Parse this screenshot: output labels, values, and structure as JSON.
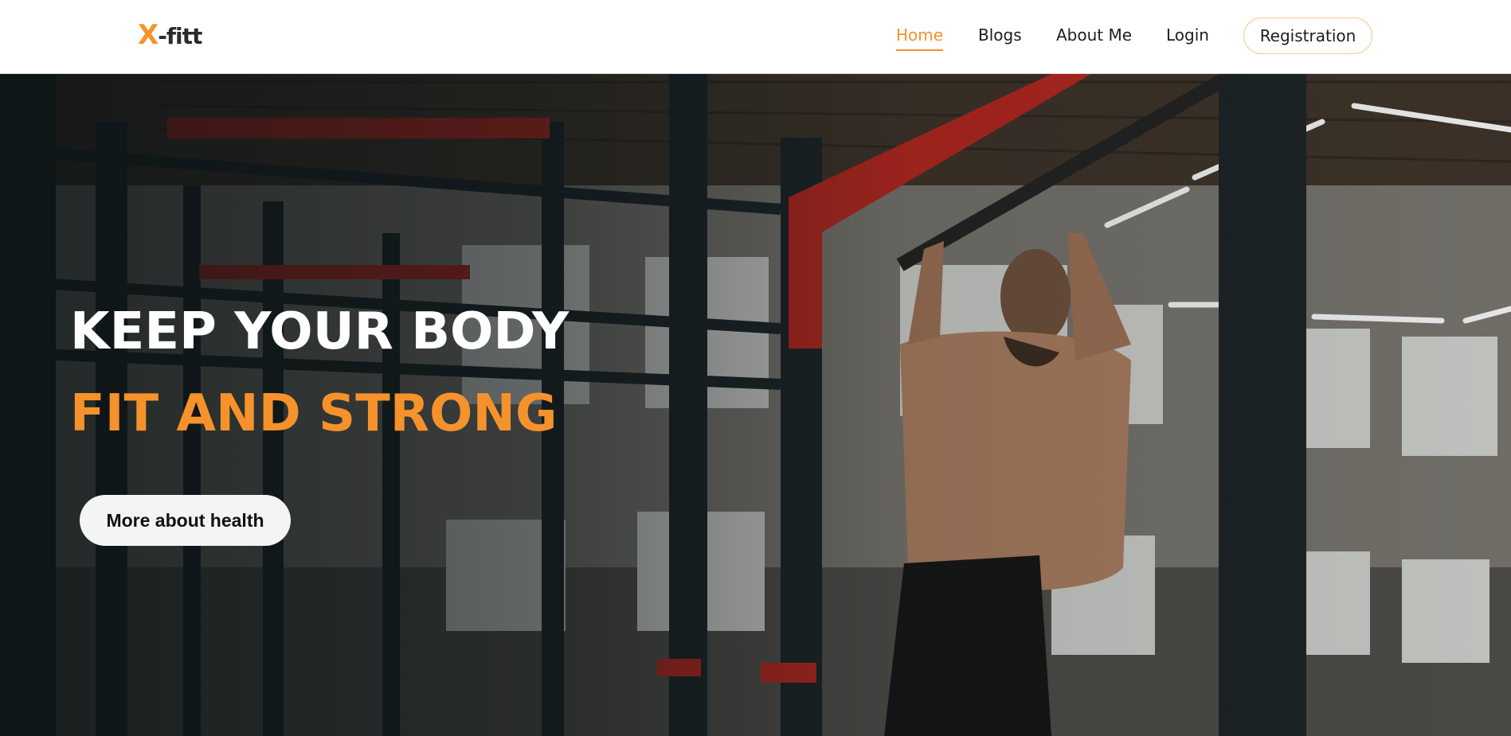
{
  "brand": {
    "logo_x": "X",
    "logo_rest": "-fitt"
  },
  "nav": {
    "links": [
      {
        "label": "Home",
        "active": true
      },
      {
        "label": "Blogs",
        "active": false
      },
      {
        "label": "About Me",
        "active": false
      },
      {
        "label": "Login",
        "active": false
      }
    ],
    "registration_label": "Registration"
  },
  "hero": {
    "line1": "KEEP YOUR BODY",
    "line2": "FIT AND STRONG",
    "cta_label": "More about health",
    "image_subject": "man doing pull-ups in gym"
  },
  "colors": {
    "accent": "#f5922b",
    "text": "#1d1d1d"
  }
}
